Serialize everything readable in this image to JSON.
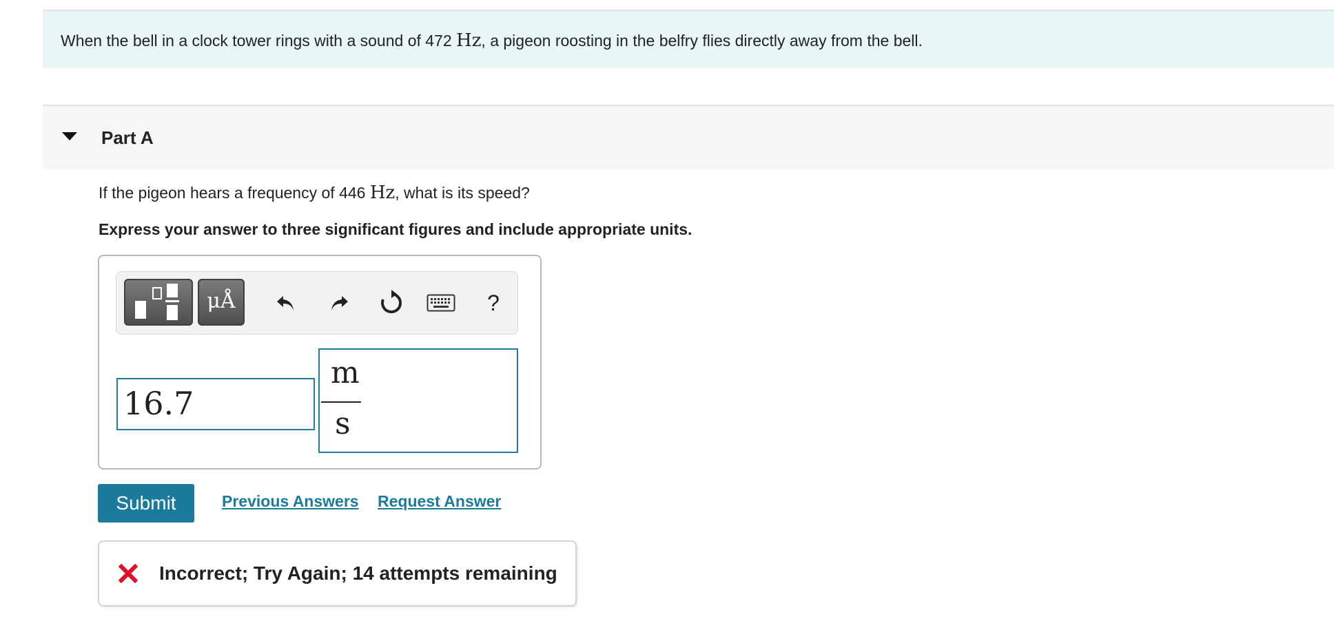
{
  "problem": {
    "intro_before": "When the bell in a clock tower rings with a sound of 472 ",
    "intro_unit": "Hz",
    "intro_after": ", a pigeon roosting in the belfry flies directly away from the bell."
  },
  "part": {
    "title": "Part A",
    "question_before": "If the pigeon hears a frequency of 446 ",
    "question_unit": "Hz",
    "question_after": ", what is its speed?",
    "instruction": "Express your answer to three significant figures and include appropriate units."
  },
  "toolbar": {
    "units_label": "μÅ",
    "help_label": "?"
  },
  "answer": {
    "value": "16.7",
    "unit_numerator": "m",
    "unit_denominator": "s"
  },
  "actions": {
    "submit_label": "Submit",
    "previous_answers_label": "Previous Answers",
    "request_answer_label": "Request Answer"
  },
  "feedback": {
    "message": "Incorrect; Try Again; 14 attempts remaining",
    "status_color": "#e0102a"
  },
  "colors": {
    "accent": "#1a7b9c",
    "intro_background": "#e8f6f6"
  }
}
